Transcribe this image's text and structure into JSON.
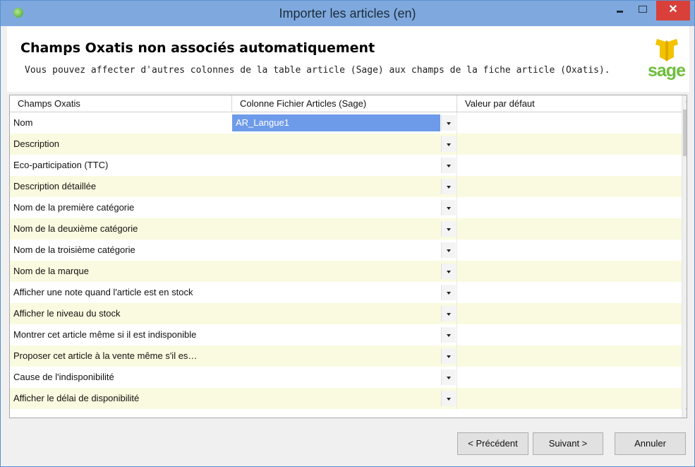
{
  "window": {
    "title": "Importer les articles (en)",
    "close_glyph": "✕"
  },
  "header": {
    "title": "Champs Oxatis non associés automatiquement",
    "subtitle": "Vous pouvez affecter d'autres colonnes de la table article (Sage) aux champs de la fiche article (Oxatis).",
    "logo_text": "sage"
  },
  "grid": {
    "columns": [
      "Champs Oxatis",
      "Colonne Fichier Articles (Sage)",
      "Valeur par défaut"
    ],
    "rows": [
      {
        "field": "Nom",
        "column": "AR_Langue1",
        "default": ""
      },
      {
        "field": "Description",
        "column": "",
        "default": ""
      },
      {
        "field": "Eco-participation (TTC)",
        "column": "",
        "default": ""
      },
      {
        "field": "Description détaillée",
        "column": "",
        "default": ""
      },
      {
        "field": "Nom de la première catégorie",
        "column": "",
        "default": ""
      },
      {
        "field": "Nom de la deuxième catégorie",
        "column": "",
        "default": ""
      },
      {
        "field": "Nom de la troisième catégorie",
        "column": "",
        "default": ""
      },
      {
        "field": "Nom de la marque",
        "column": "",
        "default": ""
      },
      {
        "field": "Afficher une note quand l'article est en stock",
        "column": "",
        "default": ""
      },
      {
        "field": "Afficher le niveau du stock",
        "column": "",
        "default": ""
      },
      {
        "field": "Montrer cet article même si il est indisponible",
        "column": "",
        "default": ""
      },
      {
        "field": "Proposer cet article à la vente même s'il es…",
        "column": "",
        "default": ""
      },
      {
        "field": "Cause de l'indisponibilité",
        "column": "",
        "default": ""
      },
      {
        "field": "Afficher le délai de disponibilité",
        "column": "",
        "default": ""
      }
    ]
  },
  "buttons": {
    "prev": "< Précédent",
    "next": "Suivant >",
    "cancel": "Annuler"
  },
  "colors": {
    "titlebar": "#7fa9de",
    "close": "#d9403a",
    "row_alt": "#fafae0",
    "selected": "#6e9be9",
    "logo_green": "#6dbe3a",
    "logo_yellow": "#f3c300"
  },
  "icons": [
    "app-icon",
    "minimize-icon",
    "maximize-icon",
    "close-icon",
    "sage-logo",
    "chevron-down-icon",
    "scroll-up-icon",
    "scroll-down-icon"
  ]
}
